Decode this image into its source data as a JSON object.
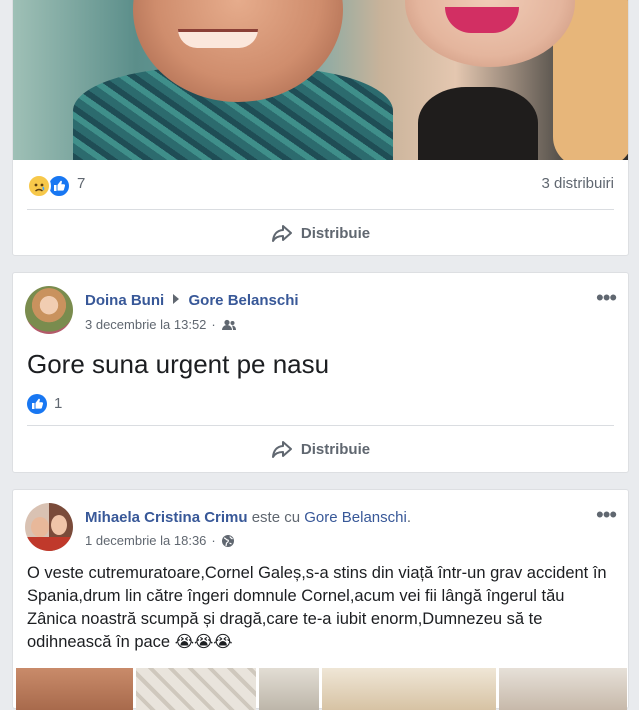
{
  "post1": {
    "reactions_count": "7",
    "shares": "3 distribuiri",
    "share_label": "Distribuie"
  },
  "post2": {
    "author": "Doina Buni",
    "target": "Gore Belanschi",
    "date": "3 decembrie la 13:52",
    "separator": "·",
    "text": "Gore suna urgent pe nasu",
    "reactions_count": "1",
    "share_label": "Distribuie"
  },
  "post3": {
    "author": "Mihaela Cristina Crimu",
    "with_text": "este cu",
    "with_person": "Gore Belanschi",
    "period": ".",
    "date": "1 decembrie la 18:36",
    "separator": "·",
    "text": "O veste cutremuratoare,Cornel Galeș,s-a stins din viață într-un grav accident în Spania,drum lin către îngeri domnule Cornel,acum vei fii lângă îngerul tău Zânica noastră scumpă și dragă,care te-a iubit enorm,Dumnezeu să te odihnească în pace 😭😭😭"
  },
  "icons": {
    "like": "like-reaction-icon",
    "sad": "sad-reaction-icon",
    "share": "share-arrow-icon",
    "friends": "friends-audience-icon",
    "globe": "globe-audience-icon",
    "more": "more-options-icon"
  },
  "colors": {
    "link": "#385898",
    "like_blue": "#1877f2",
    "muted": "#606770"
  }
}
